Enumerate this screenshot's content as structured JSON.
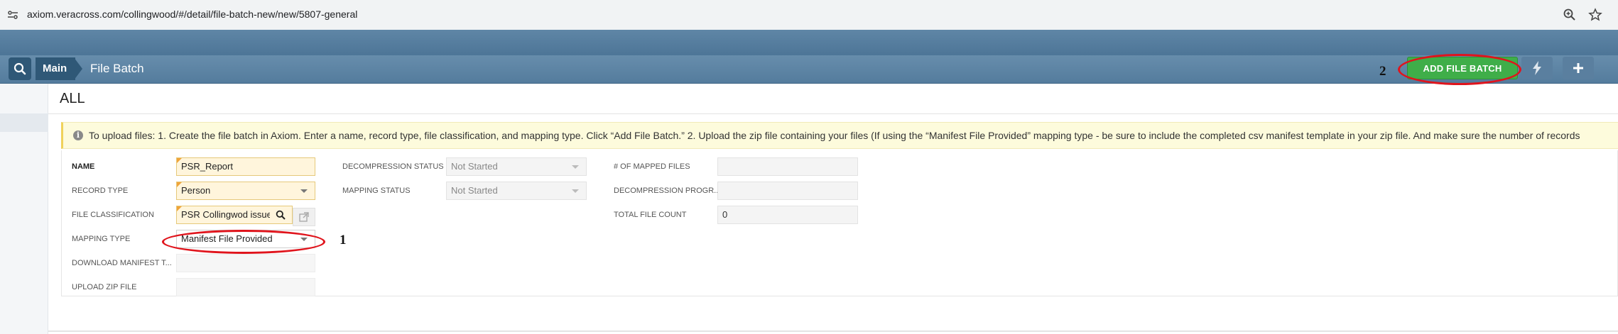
{
  "browser": {
    "url": "axiom.veracross.com/collingwood/#/detail/file-batch-new/new/5807-general"
  },
  "nav": {
    "main_label": "Main",
    "title": "File Batch",
    "add_button_label": "ADD FILE BATCH",
    "annotation_add": "2"
  },
  "page": {
    "heading": "ALL",
    "notice": "To upload files: 1. Create the file batch in Axiom. Enter a name, record type, file classification, and mapping type. Click “Add File Batch.” 2. Upload the zip file containing your files (If using the “Manifest File Provided” mapping type - be sure to include the completed csv manifest template in your zip file. And make sure the number of records"
  },
  "form": {
    "name_label": "NAME",
    "name_value": "PSR_Report",
    "record_type_label": "RECORD TYPE",
    "record_type_value": "Person",
    "file_classification_label": "FILE CLASSIFICATION",
    "file_classification_value": "PSR Collingwod issue",
    "mapping_type_label": "MAPPING TYPE",
    "mapping_type_value": "Manifest File Provided",
    "annotation_mapping": "1",
    "download_manifest_label": "DOWNLOAD MANIFEST T...",
    "upload_zip_label": "UPLOAD ZIP FILE",
    "decompression_status_label": "DECOMPRESSION STATUS",
    "decompression_status_value": "Not Started",
    "mapping_status_label": "MAPPING STATUS",
    "mapping_status_value": "Not Started",
    "mapped_files_label": "# OF MAPPED FILES",
    "decompression_progress_label": "DECOMPRESSION PROGR...",
    "total_file_count_label": "TOTAL FILE COUNT",
    "total_file_count_value": "0"
  },
  "colors": {
    "add_button": "#3fae49",
    "nav_dark": "#2f5877",
    "annotation_ring": "#e0141c",
    "required_field": "#fff5dc"
  }
}
